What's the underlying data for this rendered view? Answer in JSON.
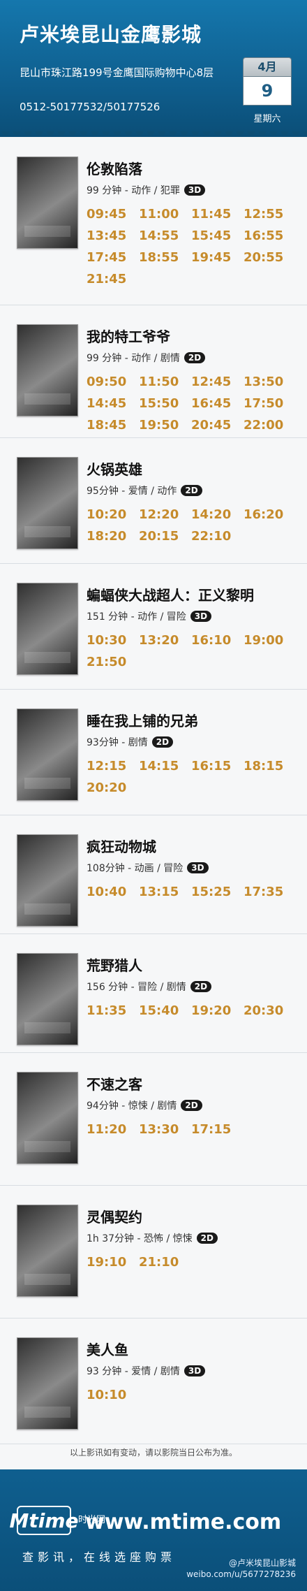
{
  "header": {
    "title": "卢米埃昆山金鹰影城",
    "address": "昆山市珠江路199号金鹰国际购物中心8层",
    "phone": "0512-50177532/50177526",
    "date": {
      "month": "4月",
      "day": "9",
      "weekday": "星期六"
    }
  },
  "movies": [
    {
      "title": "伦敦陷落",
      "meta": "99 分钟 - 动作 / 犯罪",
      "format": "3D",
      "times": [
        "09:45",
        "11:00",
        "11:45",
        "12:55",
        "13:45",
        "14:55",
        "15:45",
        "16:55",
        "17:45",
        "18:55",
        "19:45",
        "20:55",
        "21:45"
      ]
    },
    {
      "title": "我的特工爷爷",
      "meta": "99 分钟 - 动作 / 剧情",
      "format": "2D",
      "times": [
        "09:50",
        "11:50",
        "12:45",
        "13:50",
        "14:45",
        "15:50",
        "16:45",
        "17:50",
        "18:45",
        "19:50",
        "20:45",
        "22:00"
      ]
    },
    {
      "title": "火锅英雄",
      "meta": "95分钟 - 爱情 / 动作",
      "format": "2D",
      "times": [
        "10:20",
        "12:20",
        "14:20",
        "16:20",
        "18:20",
        "20:15",
        "22:10"
      ]
    },
    {
      "title": "蝙蝠侠大战超人：正义黎明",
      "meta": "151 分钟 - 动作 / 冒险",
      "format": "3D",
      "times": [
        "10:30",
        "13:20",
        "16:10",
        "19:00",
        "21:50"
      ]
    },
    {
      "title": "睡在我上铺的兄弟",
      "meta": "93分钟 - 剧情",
      "format": "2D",
      "times": [
        "12:15",
        "14:15",
        "16:15",
        "18:15",
        "20:20"
      ]
    },
    {
      "title": "疯狂动物城",
      "meta": "108分钟 - 动画 / 冒险",
      "format": "3D",
      "times": [
        "10:40",
        "13:15",
        "15:25",
        "17:35"
      ]
    },
    {
      "title": "荒野猎人",
      "meta": "156 分钟 - 冒险 / 剧情",
      "format": "2D",
      "times": [
        "11:35",
        "15:40",
        "19:20",
        "20:30"
      ]
    },
    {
      "title": "不速之客",
      "meta": "94分钟 - 惊悚 / 剧情",
      "format": "2D",
      "times": [
        "11:20",
        "13:30",
        "17:15"
      ]
    },
    {
      "title": "灵偶契约",
      "meta": "1h 37分钟 - 恐怖 / 惊悚",
      "format": "2D",
      "times": [
        "19:10",
        "21:10"
      ]
    },
    {
      "title": "美人鱼",
      "meta": "93 分钟 - 爱情 / 剧情",
      "format": "3D",
      "times": [
        "10:10"
      ]
    }
  ],
  "footer": {
    "notice": "以上影讯如有变动，请以影院当日公布为准。",
    "brand": "Mtime",
    "brand_small": "时光网",
    "url": "www.mtime.com",
    "slogan": "查影讯，在线选座购票",
    "weibo_line1": "@卢米埃昆山影城",
    "weibo_line2": "weibo.com/u/5677278236"
  }
}
